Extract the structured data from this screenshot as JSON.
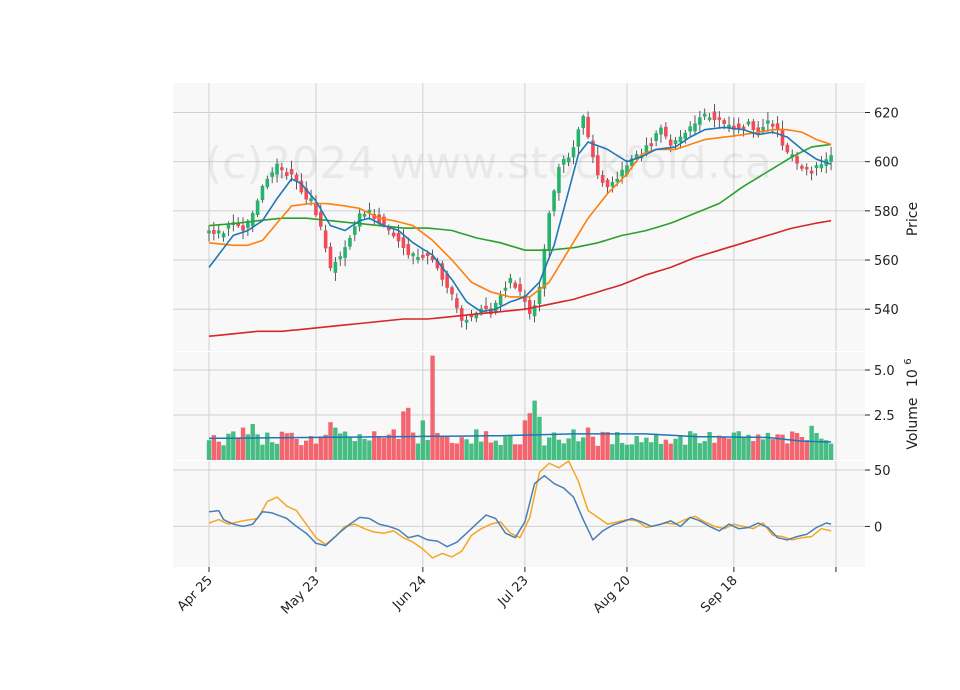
{
  "chart_data": {
    "type": "candlestick",
    "watermark": "(c)2024 www.stockfold.ca",
    "colors": {
      "up": "#26b36e",
      "down": "#f24b57",
      "panel_bg": "#f8f8f8",
      "grid": "#d0d0d0",
      "sma_fast": "#1f77b4",
      "sma_mid": "#ff7f0e",
      "sma_slow": "#2ca02c",
      "sma_long": "#d62728",
      "volume_avg": "#1f77b4",
      "osc_fast": "#4a7fb5",
      "osc_slow": "#f5a623"
    },
    "x_tick_labels": [
      "Apr 25",
      "May 23",
      "Jun 24",
      "Jul 23",
      "Aug 20",
      "Sep 18"
    ],
    "price_panel": {
      "ylabel": "Price",
      "ylim": [
        523,
        632
      ],
      "yticks": [
        540,
        560,
        580,
        600,
        620
      ],
      "candle_anchors": [
        [
          0,
          572
        ],
        [
          2,
          570
        ],
        [
          5,
          575
        ],
        [
          7,
          573
        ],
        [
          9,
          578
        ],
        [
          11,
          590
        ],
        [
          14,
          598
        ],
        [
          17,
          594
        ],
        [
          19,
          588
        ],
        [
          21,
          583
        ],
        [
          23,
          573
        ],
        [
          25,
          556
        ],
        [
          27,
          562
        ],
        [
          29,
          570
        ],
        [
          31,
          578
        ],
        [
          33,
          580
        ],
        [
          35,
          576
        ],
        [
          38,
          570
        ],
        [
          40,
          566
        ],
        [
          42,
          560
        ],
        [
          45,
          563
        ],
        [
          47,
          557
        ],
        [
          50,
          545
        ],
        [
          52,
          536
        ],
        [
          54,
          537
        ],
        [
          56,
          541
        ],
        [
          58,
          539
        ],
        [
          60,
          546
        ],
        [
          62,
          552
        ],
        [
          64,
          547
        ],
        [
          66,
          537
        ],
        [
          68,
          548
        ],
        [
          70,
          580
        ],
        [
          72,
          598
        ],
        [
          75,
          605
        ],
        [
          77,
          619
        ],
        [
          78,
          610
        ],
        [
          80,
          595
        ],
        [
          82,
          589
        ],
        [
          85,
          596
        ],
        [
          87,
          601
        ],
        [
          89,
          604
        ],
        [
          91,
          608
        ],
        [
          93,
          613
        ],
        [
          95,
          606
        ],
        [
          97,
          610
        ],
        [
          99,
          614
        ],
        [
          101,
          617
        ],
        [
          103,
          619
        ],
        [
          105,
          616
        ],
        [
          107,
          614
        ],
        [
          109,
          614
        ],
        [
          111,
          616
        ],
        [
          113,
          611
        ],
        [
          115,
          617
        ],
        [
          117,
          612
        ],
        [
          119,
          603
        ],
        [
          121,
          598
        ],
        [
          123,
          596
        ],
        [
          125,
          597
        ],
        [
          127,
          601
        ],
        [
          128,
          602
        ]
      ],
      "sma_fast_anchors": [
        [
          0,
          557
        ],
        [
          5,
          570
        ],
        [
          8,
          572
        ],
        [
          11,
          576
        ],
        [
          14,
          585
        ],
        [
          17,
          593
        ],
        [
          19,
          591
        ],
        [
          22,
          584
        ],
        [
          25,
          574
        ],
        [
          28,
          572
        ],
        [
          31,
          576
        ],
        [
          33,
          577
        ],
        [
          36,
          574
        ],
        [
          39,
          572
        ],
        [
          42,
          567
        ],
        [
          46,
          562
        ],
        [
          50,
          552
        ],
        [
          53,
          543
        ],
        [
          56,
          539
        ],
        [
          59,
          540
        ],
        [
          62,
          543
        ],
        [
          65,
          545
        ],
        [
          68,
          551
        ],
        [
          71,
          566
        ],
        [
          74,
          588
        ],
        [
          76,
          603
        ],
        [
          78,
          608
        ],
        [
          82,
          605
        ],
        [
          86,
          600
        ],
        [
          89,
          602
        ],
        [
          92,
          605
        ],
        [
          96,
          606
        ],
        [
          99,
          610
        ],
        [
          102,
          613
        ],
        [
          106,
          614
        ],
        [
          110,
          613
        ],
        [
          113,
          611
        ],
        [
          116,
          612
        ],
        [
          119,
          610
        ],
        [
          122,
          605
        ],
        [
          125,
          601
        ],
        [
          128,
          599
        ]
      ],
      "sma_mid_anchors": [
        [
          0,
          567
        ],
        [
          5,
          566
        ],
        [
          8,
          566
        ],
        [
          11,
          568
        ],
        [
          14,
          575
        ],
        [
          17,
          582
        ],
        [
          21,
          583
        ],
        [
          24,
          583
        ],
        [
          28,
          582
        ],
        [
          31,
          581
        ],
        [
          35,
          577
        ],
        [
          38,
          576
        ],
        [
          42,
          574
        ],
        [
          46,
          568
        ],
        [
          50,
          560
        ],
        [
          54,
          551
        ],
        [
          58,
          547
        ],
        [
          62,
          545
        ],
        [
          66,
          545
        ],
        [
          70,
          551
        ],
        [
          74,
          564
        ],
        [
          78,
          577
        ],
        [
          82,
          587
        ],
        [
          86,
          595
        ],
        [
          89,
          603
        ],
        [
          92,
          605
        ],
        [
          96,
          605
        ],
        [
          99,
          607
        ],
        [
          102,
          609
        ],
        [
          106,
          610
        ],
        [
          110,
          611
        ],
        [
          113,
          612
        ],
        [
          116,
          613
        ],
        [
          119,
          613
        ],
        [
          122,
          612
        ],
        [
          125,
          609
        ],
        [
          128,
          607
        ]
      ],
      "sma_slow_anchors": [
        [
          0,
          574
        ],
        [
          6,
          575
        ],
        [
          10,
          576
        ],
        [
          15,
          577
        ],
        [
          20,
          577
        ],
        [
          25,
          576
        ],
        [
          30,
          575
        ],
        [
          35,
          574
        ],
        [
          40,
          573
        ],
        [
          45,
          573
        ],
        [
          50,
          572
        ],
        [
          55,
          569
        ],
        [
          60,
          567
        ],
        [
          65,
          564
        ],
        [
          70,
          564
        ],
        [
          75,
          565
        ],
        [
          80,
          567
        ],
        [
          85,
          570
        ],
        [
          90,
          572
        ],
        [
          95,
          575
        ],
        [
          100,
          579
        ],
        [
          105,
          583
        ],
        [
          110,
          590
        ],
        [
          115,
          596
        ],
        [
          120,
          602
        ],
        [
          124,
          606
        ],
        [
          128,
          607
        ]
      ],
      "sma_long_anchors": [
        [
          0,
          529
        ],
        [
          5,
          530
        ],
        [
          10,
          531
        ],
        [
          15,
          531
        ],
        [
          20,
          532
        ],
        [
          25,
          533
        ],
        [
          30,
          534
        ],
        [
          35,
          535
        ],
        [
          40,
          536
        ],
        [
          45,
          536
        ],
        [
          50,
          537
        ],
        [
          55,
          538
        ],
        [
          60,
          539
        ],
        [
          65,
          540
        ],
        [
          70,
          542
        ],
        [
          75,
          544
        ],
        [
          80,
          547
        ],
        [
          85,
          550
        ],
        [
          90,
          554
        ],
        [
          95,
          557
        ],
        [
          100,
          561
        ],
        [
          105,
          564
        ],
        [
          110,
          567
        ],
        [
          115,
          570
        ],
        [
          120,
          573
        ],
        [
          125,
          575
        ],
        [
          128,
          576
        ]
      ]
    },
    "volume_panel": {
      "ylabel": "Volume",
      "ylabel_exponent": "6",
      "ylabel_base": "10",
      "ylim": [
        0,
        6.0
      ],
      "yticks": [
        2.5,
        5.0
      ],
      "ytick_labels": [
        "2.5",
        "5.0"
      ],
      "baseline_level": 1.4,
      "spikes": [
        [
          7,
          1.8
        ],
        [
          9,
          2.0
        ],
        [
          25,
          2.1
        ],
        [
          26,
          1.8
        ],
        [
          38,
          1.7
        ],
        [
          40,
          2.7
        ],
        [
          41,
          2.9
        ],
        [
          44,
          2.2
        ],
        [
          46,
          5.8
        ],
        [
          55,
          1.7
        ],
        [
          57,
          1.6
        ],
        [
          62,
          1.4
        ],
        [
          65,
          2.2
        ],
        [
          66,
          2.6
        ],
        [
          67,
          3.3
        ],
        [
          68,
          2.4
        ],
        [
          75,
          1.7
        ],
        [
          78,
          1.8
        ],
        [
          99,
          1.6
        ],
        [
          109,
          1.6
        ],
        [
          124,
          1.9
        ],
        [
          127,
          1.1
        ]
      ],
      "volume_avg_anchors": [
        [
          0,
          1.2
        ],
        [
          20,
          1.25
        ],
        [
          40,
          1.3
        ],
        [
          60,
          1.35
        ],
        [
          75,
          1.45
        ],
        [
          90,
          1.45
        ],
        [
          100,
          1.3
        ],
        [
          115,
          1.25
        ],
        [
          122,
          1.05
        ],
        [
          128,
          1.0
        ]
      ]
    },
    "oscillator_panel": {
      "ylim": [
        -36,
        58
      ],
      "yticks": [
        0,
        50
      ],
      "ytick_labels": [
        "0",
        "50"
      ],
      "fast_anchors": [
        [
          0,
          13
        ],
        [
          2,
          14
        ],
        [
          3,
          6
        ],
        [
          5,
          2
        ],
        [
          7,
          0
        ],
        [
          9,
          2
        ],
        [
          11,
          13
        ],
        [
          13,
          12
        ],
        [
          16,
          7
        ],
        [
          18,
          0
        ],
        [
          20,
          -6
        ],
        [
          22,
          -15
        ],
        [
          24,
          -17
        ],
        [
          27,
          -5
        ],
        [
          29,
          2
        ],
        [
          31,
          8
        ],
        [
          33,
          7
        ],
        [
          35,
          2
        ],
        [
          37,
          0
        ],
        [
          39,
          -3
        ],
        [
          41,
          -10
        ],
        [
          43,
          -8
        ],
        [
          45,
          -12
        ],
        [
          47,
          -13
        ],
        [
          49,
          -18
        ],
        [
          51,
          -14
        ],
        [
          53,
          -6
        ],
        [
          55,
          2
        ],
        [
          57,
          10
        ],
        [
          59,
          7
        ],
        [
          61,
          -6
        ],
        [
          63,
          -10
        ],
        [
          65,
          4
        ],
        [
          67,
          38
        ],
        [
          69,
          45
        ],
        [
          71,
          38
        ],
        [
          73,
          34
        ],
        [
          75,
          26
        ],
        [
          77,
          6
        ],
        [
          79,
          -12
        ],
        [
          81,
          -4
        ],
        [
          83,
          1
        ],
        [
          85,
          4
        ],
        [
          87,
          7
        ],
        [
          89,
          4
        ],
        [
          91,
          0
        ],
        [
          93,
          2
        ],
        [
          95,
          5
        ],
        [
          97,
          0
        ],
        [
          99,
          8
        ],
        [
          101,
          5
        ],
        [
          103,
          0
        ],
        [
          105,
          -4
        ],
        [
          107,
          2
        ],
        [
          109,
          -2
        ],
        [
          111,
          -1
        ],
        [
          113,
          3
        ],
        [
          115,
          -1
        ],
        [
          117,
          -10
        ],
        [
          119,
          -12
        ],
        [
          121,
          -9
        ],
        [
          123,
          -7
        ],
        [
          125,
          -1
        ],
        [
          127,
          3
        ],
        [
          128,
          2
        ]
      ],
      "slow_anchors": [
        [
          0,
          3
        ],
        [
          2,
          6
        ],
        [
          4,
          2
        ],
        [
          7,
          5
        ],
        [
          10,
          7
        ],
        [
          12,
          22
        ],
        [
          14,
          26
        ],
        [
          16,
          18
        ],
        [
          18,
          14
        ],
        [
          20,
          2
        ],
        [
          22,
          -10
        ],
        [
          24,
          -16
        ],
        [
          26,
          -9
        ],
        [
          28,
          0
        ],
        [
          30,
          2
        ],
        [
          32,
          -2
        ],
        [
          34,
          -5
        ],
        [
          36,
          -6
        ],
        [
          38,
          -4
        ],
        [
          40,
          -10
        ],
        [
          42,
          -14
        ],
        [
          44,
          -20
        ],
        [
          46,
          -28
        ],
        [
          48,
          -24
        ],
        [
          50,
          -27
        ],
        [
          52,
          -22
        ],
        [
          54,
          -8
        ],
        [
          56,
          -2
        ],
        [
          58,
          2
        ],
        [
          60,
          4
        ],
        [
          62,
          -6
        ],
        [
          64,
          -10
        ],
        [
          66,
          8
        ],
        [
          68,
          48
        ],
        [
          70,
          56
        ],
        [
          72,
          52
        ],
        [
          74,
          58
        ],
        [
          76,
          40
        ],
        [
          78,
          14
        ],
        [
          80,
          8
        ],
        [
          82,
          2
        ],
        [
          84,
          4
        ],
        [
          86,
          6
        ],
        [
          88,
          5
        ],
        [
          90,
          -1
        ],
        [
          92,
          1
        ],
        [
          94,
          3
        ],
        [
          96,
          2
        ],
        [
          98,
          6
        ],
        [
          100,
          9
        ],
        [
          102,
          4
        ],
        [
          104,
          0
        ],
        [
          106,
          -2
        ],
        [
          108,
          2
        ],
        [
          110,
          0
        ],
        [
          112,
          -2
        ],
        [
          114,
          3
        ],
        [
          116,
          -8
        ],
        [
          118,
          -9
        ],
        [
          120,
          -12
        ],
        [
          122,
          -10
        ],
        [
          124,
          -9
        ],
        [
          126,
          -2
        ],
        [
          128,
          -4
        ]
      ]
    }
  }
}
